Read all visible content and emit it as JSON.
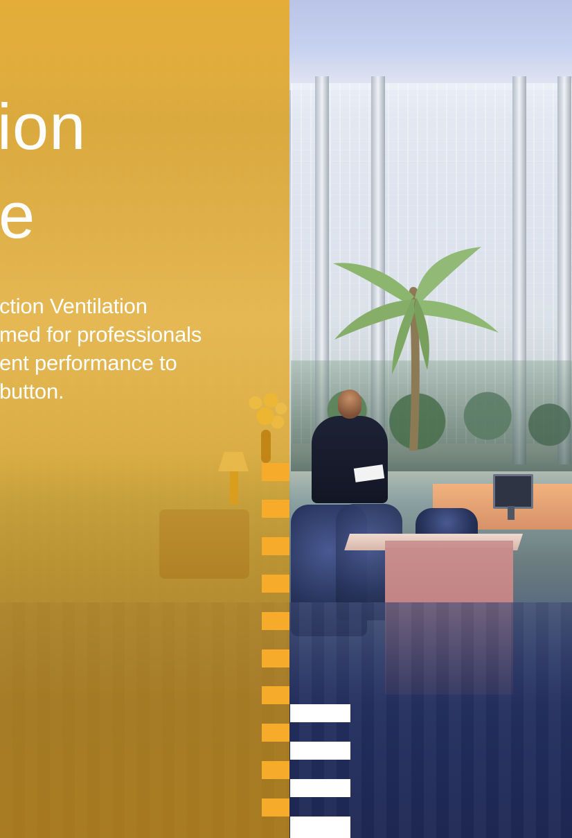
{
  "hero": {
    "title_line_1": "ion",
    "title_line_2": "e",
    "body_lines": [
      "ction Ventilation",
      "med for professionals",
      "ent performance to",
      "button."
    ]
  },
  "colors": {
    "overlay": "#E4A312",
    "text": "#FFFFFF",
    "accent_bar": "#F6AC2A",
    "white_bar": "#FFFFFF"
  }
}
